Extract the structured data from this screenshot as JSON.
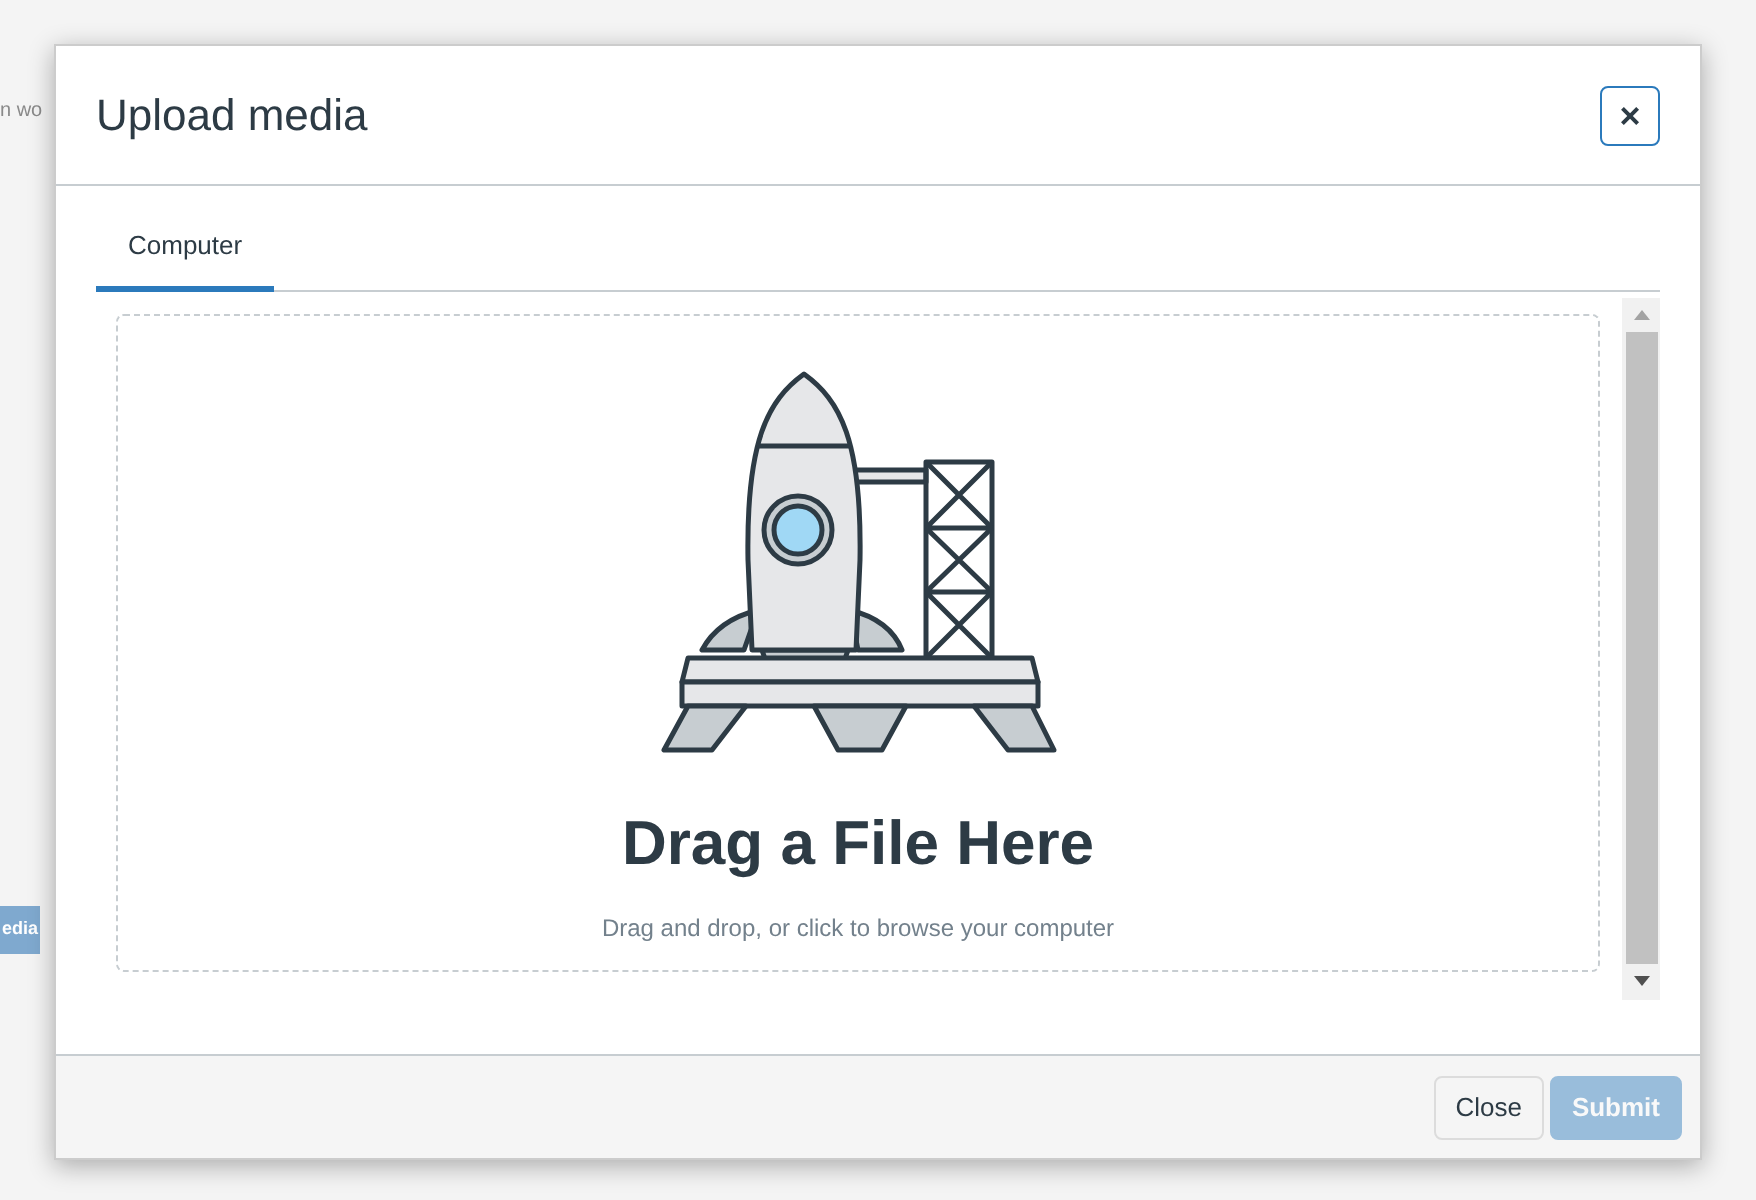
{
  "background": {
    "text_fragment": "n wo",
    "button_fragment": "edia"
  },
  "dialog": {
    "title": "Upload media",
    "close_icon": "×"
  },
  "tabs": [
    {
      "label": "Computer",
      "selected": true
    }
  ],
  "dropzone": {
    "heading": "Drag a File Here",
    "hint": "Drag and drop, or click to browse your computer"
  },
  "buttons": [
    {
      "label": "Close",
      "kind": "secondary",
      "disabled": false
    },
    {
      "label": "Submit",
      "kind": "primary",
      "disabled": true
    }
  ]
}
